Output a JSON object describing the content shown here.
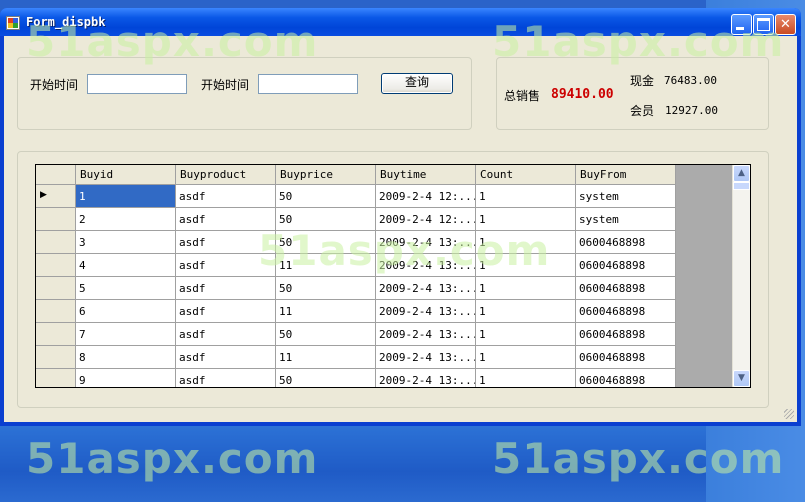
{
  "window": {
    "title": "Form_dispbk"
  },
  "filter": {
    "start_label_1": "开始时间",
    "start_value_1": "",
    "start_label_2": "开始时间",
    "start_value_2": "",
    "query_button": "查询"
  },
  "summary": {
    "total_label": "总销售",
    "total_value": "89410.00",
    "cash_label": "现金",
    "cash_value": "76483.00",
    "member_label": "会员",
    "member_value": "12927.00"
  },
  "grid": {
    "columns": [
      "Buyid",
      "Buyproduct",
      "Buyprice",
      "Buytime",
      "Count",
      "BuyFrom"
    ],
    "rows": [
      [
        "1",
        "asdf",
        "50",
        "2009-2-4 12:...",
        "1",
        "system"
      ],
      [
        "2",
        "asdf",
        "50",
        "2009-2-4 12:...",
        "1",
        "system"
      ],
      [
        "3",
        "asdf",
        "50",
        "2009-2-4 13:...",
        "1",
        "0600468898"
      ],
      [
        "4",
        "asdf",
        "11",
        "2009-2-4 13:...",
        "1",
        "0600468898"
      ],
      [
        "5",
        "asdf",
        "50",
        "2009-2-4 13:...",
        "1",
        "0600468898"
      ],
      [
        "6",
        "asdf",
        "11",
        "2009-2-4 13:...",
        "1",
        "0600468898"
      ],
      [
        "7",
        "asdf",
        "50",
        "2009-2-4 13:...",
        "1",
        "0600468898"
      ],
      [
        "8",
        "asdf",
        "11",
        "2009-2-4 13:...",
        "1",
        "0600468898"
      ],
      [
        "9",
        "asdf",
        "50",
        "2009-2-4 13:...",
        "1",
        "0600468898"
      ]
    ],
    "current_row_marker": "▶"
  },
  "watermark": {
    "text": "51aspx.com"
  },
  "colors": {
    "title_bar": "#0a57e6",
    "total_value": "#cc0000",
    "selection": "#316ac5",
    "client": "#ece9d8"
  }
}
